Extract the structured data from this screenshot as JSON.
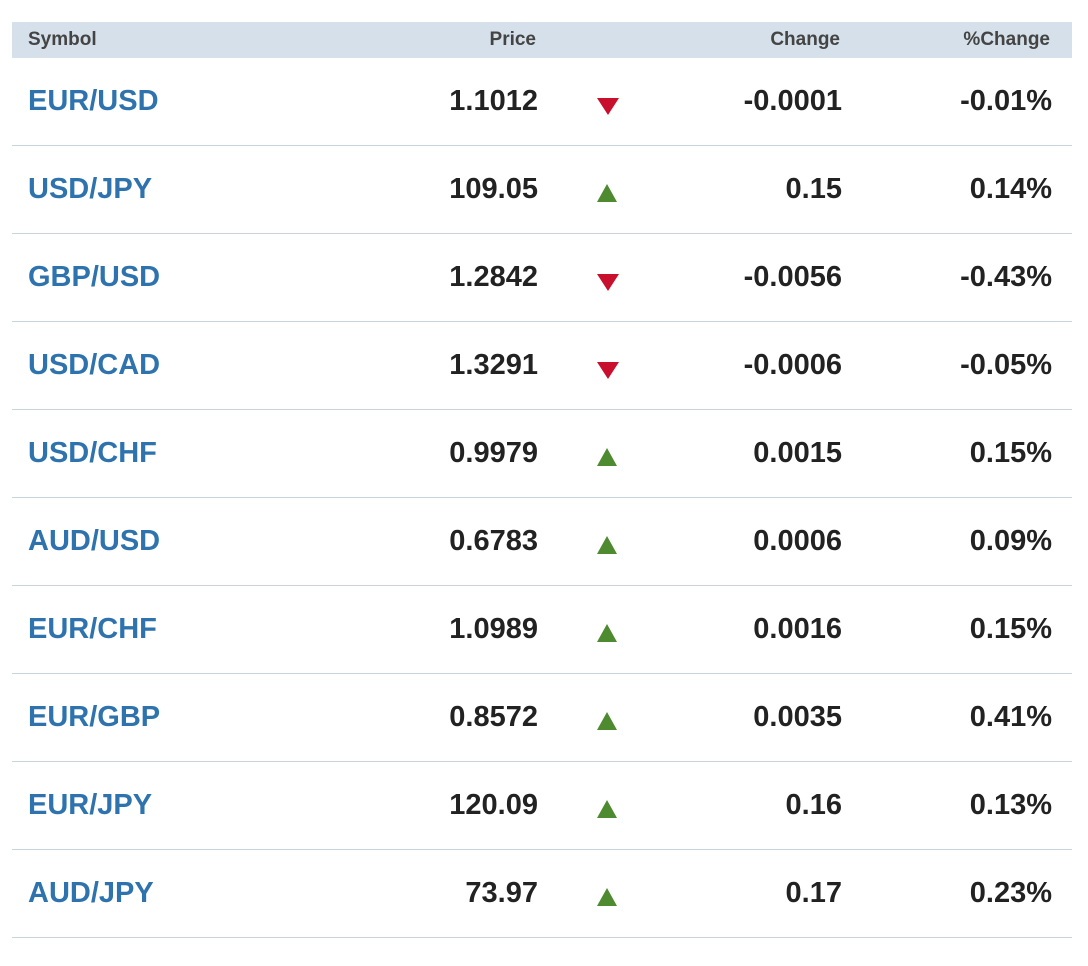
{
  "header": {
    "symbol": "Symbol",
    "price": "Price",
    "change": "Change",
    "pct_change": "%Change"
  },
  "colors": {
    "symbol_link": "#2e73ad",
    "down": "#c8102e",
    "up": "#4e8a2f",
    "header_bg": "#d5e0ea"
  },
  "rows": [
    {
      "symbol": "EUR/USD",
      "price": "1.1012",
      "direction": "down",
      "change": "-0.0001",
      "pct": "-0.01%"
    },
    {
      "symbol": "USD/JPY",
      "price": "109.05",
      "direction": "up",
      "change": "0.15",
      "pct": "0.14%"
    },
    {
      "symbol": "GBP/USD",
      "price": "1.2842",
      "direction": "down",
      "change": "-0.0056",
      "pct": "-0.43%"
    },
    {
      "symbol": "USD/CAD",
      "price": "1.3291",
      "direction": "down",
      "change": "-0.0006",
      "pct": "-0.05%"
    },
    {
      "symbol": "USD/CHF",
      "price": "0.9979",
      "direction": "up",
      "change": "0.0015",
      "pct": "0.15%"
    },
    {
      "symbol": "AUD/USD",
      "price": "0.6783",
      "direction": "up",
      "change": "0.0006",
      "pct": "0.09%"
    },
    {
      "symbol": "EUR/CHF",
      "price": "1.0989",
      "direction": "up",
      "change": "0.0016",
      "pct": "0.15%"
    },
    {
      "symbol": "EUR/GBP",
      "price": "0.8572",
      "direction": "up",
      "change": "0.0035",
      "pct": "0.41%"
    },
    {
      "symbol": "EUR/JPY",
      "price": "120.09",
      "direction": "up",
      "change": "0.16",
      "pct": "0.13%"
    },
    {
      "symbol": "AUD/JPY",
      "price": "73.97",
      "direction": "up",
      "change": "0.17",
      "pct": "0.23%"
    }
  ]
}
